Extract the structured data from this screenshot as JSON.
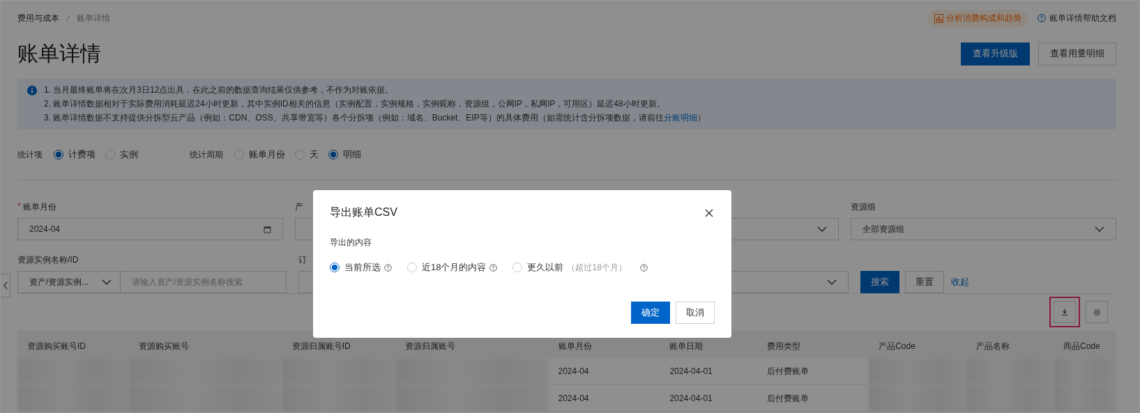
{
  "breadcrumb": [
    "费用与成本",
    "账单详情"
  ],
  "header_links": [
    {
      "kind": "analysis",
      "label": "分析消费构成和趋势"
    },
    {
      "kind": "help",
      "label": "账单详情帮助文档"
    }
  ],
  "title": "账单详情",
  "header_buttons": [
    {
      "label": "查看升级版",
      "primary": true
    },
    {
      "label": "查看用量明细",
      "primary": false
    }
  ],
  "notice": [
    {
      "text": "1. 当月最终账单将在次月3日12点出具，在此之前的数据查询结果仅供参考，不作为对账依据。"
    },
    {
      "text": "2. 账单详情数据相对于实际费用消耗延迟24小时更新，其中实例ID相关的信息（实例配置，实例规格，实例昵称，资源组，公网IP，私网IP，可用区）延迟48小时更新。"
    },
    {
      "text": "3. 账单详情数据不支持提供分拆型云产品（例如：CDN、OSS、共享带宽等）各个分拆项（例如：域名、Bucket、EIP等）的具体费用（如需统计含分拆项数据，请前往",
      "link": "分账明细",
      "tail": "）"
    }
  ],
  "filters": [
    {
      "label": "统计项",
      "options": [
        {
          "label": "计费项",
          "selected": true
        },
        {
          "label": "实例",
          "selected": false
        }
      ]
    },
    {
      "label": "统计周期",
      "options": [
        {
          "label": "账单月份",
          "selected": false
        },
        {
          "label": "天",
          "selected": false
        },
        {
          "label": "明细",
          "selected": true
        }
      ]
    }
  ],
  "required_mark": "*",
  "form_rows": [
    {
      "fields": [
        {
          "kind": "date",
          "label": "账单月份",
          "required": true,
          "value": "2024-04"
        },
        {
          "kind": "input",
          "label": "产",
          "required": false
        },
        {
          "kind": "select",
          "required": false
        },
        {
          "kind": "select",
          "label": "资源组",
          "required": false,
          "value": "全部资源组"
        }
      ]
    },
    {
      "fields": [
        {
          "kind": "combo",
          "label": "资源实例名称/ID",
          "required": false,
          "select_value": "资产/资源实例...",
          "placeholder": "请输入资产/资源实例名称搜索"
        },
        {
          "kind": "input",
          "label": "订",
          "required": false
        },
        {
          "kind": "select",
          "required": false
        }
      ],
      "actions": [
        {
          "kind": "primary",
          "label": "搜索"
        },
        {
          "kind": "default",
          "label": "重置"
        },
        {
          "kind": "link",
          "label": "收起"
        }
      ]
    }
  ],
  "toolbar": [
    {
      "kind": "download",
      "highlighted": true
    },
    {
      "kind": "settings",
      "highlighted": false
    }
  ],
  "table": {
    "columns": [
      "资源购买账号ID",
      "资源购买账号",
      "资源归属账号ID",
      "资源归属账号",
      "账单月份",
      "账单日期",
      "费用类型",
      "产品Code",
      "产品名称",
      "商品Code"
    ],
    "rows": [
      {
        "cells": [
          {
            "kind": "blurred"
          },
          {
            "kind": "blurred"
          },
          {
            "kind": "blurred"
          },
          {
            "kind": "blurred"
          },
          {
            "kind": "text",
            "text": "2024-04"
          },
          {
            "kind": "text",
            "text": "2024-04-01"
          },
          {
            "kind": "text",
            "text": "后付费账单"
          },
          {
            "kind": "blurred"
          },
          {
            "kind": "blurred"
          },
          {
            "kind": "blurred"
          }
        ]
      },
      {
        "cells": [
          {
            "kind": "blurred"
          },
          {
            "kind": "blurred"
          },
          {
            "kind": "blurred"
          },
          {
            "kind": "blurred"
          },
          {
            "kind": "text",
            "text": "2024-04"
          },
          {
            "kind": "text",
            "text": "2024-04-01"
          },
          {
            "kind": "text",
            "text": "后付费账单"
          },
          {
            "kind": "blurred"
          },
          {
            "kind": "blurred"
          },
          {
            "kind": "blurred"
          }
        ]
      }
    ]
  },
  "dialog": {
    "title": "导出账单CSV",
    "section_label": "导出的内容",
    "options": [
      {
        "label": "当前所选",
        "selected": true
      },
      {
        "label": "近18个月的内容",
        "selected": false
      },
      {
        "label": "更久以前",
        "note": "（超过18个月）",
        "selected": false
      }
    ],
    "buttons": [
      {
        "label": "确定",
        "primary": true
      },
      {
        "label": "取消",
        "primary": false
      }
    ]
  }
}
